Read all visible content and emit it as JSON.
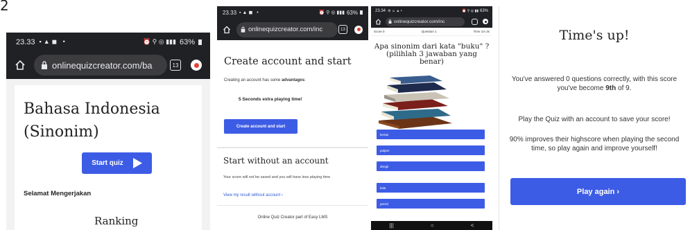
{
  "figure_number": "2",
  "panel1": {
    "status": {
      "time": "23.33",
      "battery": "63%"
    },
    "url": "onlinequizcreator.com/ba",
    "tab_count": "13",
    "title_line1": "Bahasa Indonesia",
    "title_line2": "(Sinonim)",
    "start_button": "Start quiz",
    "subtitle": "Selamat Mengerjakan",
    "ranking_heading": "Ranking"
  },
  "panel2": {
    "status": {
      "time": "23.33",
      "battery": "63%"
    },
    "url": "onlinequizcreator.com/inc",
    "tab_count": "13",
    "heading": "Create account and start",
    "advantages_prefix": "Creating an account has some ",
    "advantages_bold": "advantages",
    "advantages_suffix": ":",
    "bonus": "5 Seconds extra playing time!",
    "create_button": "Create account and start",
    "heading2": "Start without an account",
    "note": "Your score will not be saved and you will have less playing time",
    "view_link": "View my result without account ›",
    "footer": "Online Quiz Creator part of Easy LMS"
  },
  "panel3": {
    "status": {
      "time": "23.34",
      "battery": "63%"
    },
    "url": "onlinequizcreator.com/inc",
    "score_label": "Score 0",
    "question_label": "Question 1",
    "time_label": "Time 1m 3s",
    "question": "Apa sinonim dari kata \"buku\" ? (pilihlah 3 jawaban yang benar)",
    "answers": [
      "kertas",
      "pulpen",
      "dengk",
      "kala",
      "pensil"
    ],
    "nav_icons": [
      "|||",
      "○",
      "<"
    ],
    "colors": {
      "answer_bg": "#3d5ce5"
    }
  },
  "panel4": {
    "heading": "Time's up!",
    "line1_prefix": "You've answered 0 questions correctly, with this score you've become ",
    "line1_rank": "9th",
    "line1_suffix": " of 9.",
    "line2": "Play the Quiz with an account to save your score!",
    "line3": "90% improves their highscore when playing the second time, so play again and improve yourself!",
    "play_again_button": "Play again ›"
  },
  "colors": {
    "primary": "#3d5ce5",
    "chrome_dark": "#202124"
  }
}
